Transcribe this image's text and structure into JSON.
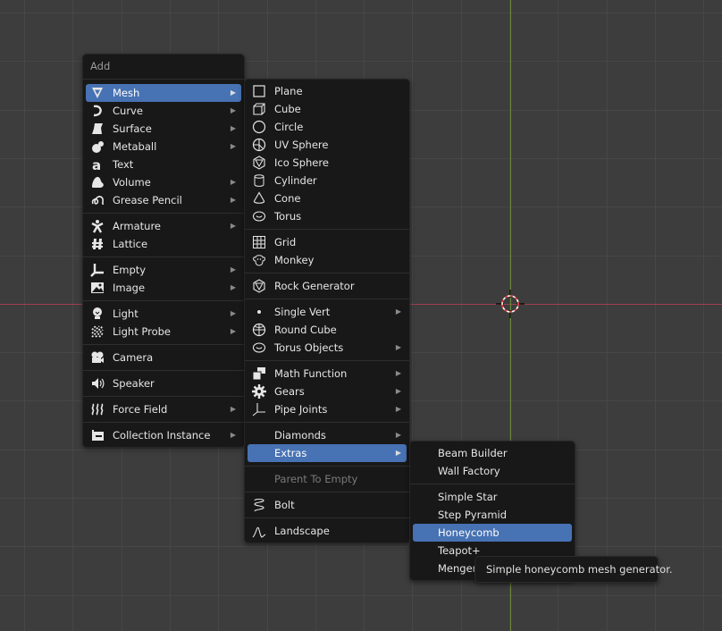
{
  "viewport": {
    "colors": {
      "background": "#3d3d3d",
      "grid": "#474747",
      "x_axis": "#a0414f",
      "y_axis": "#6c8a3a",
      "highlight": "#4772b3"
    }
  },
  "add_menu": {
    "title": "Add",
    "groups": [
      [
        {
          "label": "Mesh",
          "icon": "mesh-icon",
          "submenu": true,
          "active": true
        },
        {
          "label": "Curve",
          "icon": "curve-icon",
          "submenu": true
        },
        {
          "label": "Surface",
          "icon": "surface-icon",
          "submenu": true
        },
        {
          "label": "Metaball",
          "icon": "metaball-icon",
          "submenu": true
        },
        {
          "label": "Text",
          "icon": "text-icon",
          "submenu": false
        },
        {
          "label": "Volume",
          "icon": "volume-icon",
          "submenu": true
        },
        {
          "label": "Grease Pencil",
          "icon": "grease-pencil-icon",
          "submenu": true
        }
      ],
      [
        {
          "label": "Armature",
          "icon": "armature-icon",
          "submenu": true
        },
        {
          "label": "Lattice",
          "icon": "lattice-icon",
          "submenu": false
        }
      ],
      [
        {
          "label": "Empty",
          "icon": "empty-icon",
          "submenu": true
        },
        {
          "label": "Image",
          "icon": "image-icon",
          "submenu": true
        }
      ],
      [
        {
          "label": "Light",
          "icon": "light-icon",
          "submenu": true
        },
        {
          "label": "Light Probe",
          "icon": "light-probe-icon",
          "submenu": true
        }
      ],
      [
        {
          "label": "Camera",
          "icon": "camera-icon",
          "submenu": false
        }
      ],
      [
        {
          "label": "Speaker",
          "icon": "speaker-icon",
          "submenu": false
        }
      ],
      [
        {
          "label": "Force Field",
          "icon": "force-field-icon",
          "submenu": true
        }
      ],
      [
        {
          "label": "Collection Instance",
          "icon": "collection-instance-icon",
          "submenu": true
        }
      ]
    ]
  },
  "mesh_menu": {
    "groups": [
      [
        {
          "label": "Plane",
          "icon": "plane-icon"
        },
        {
          "label": "Cube",
          "icon": "cube-icon"
        },
        {
          "label": "Circle",
          "icon": "circle-icon"
        },
        {
          "label": "UV Sphere",
          "icon": "uv-sphere-icon"
        },
        {
          "label": "Ico Sphere",
          "icon": "ico-sphere-icon"
        },
        {
          "label": "Cylinder",
          "icon": "cylinder-icon"
        },
        {
          "label": "Cone",
          "icon": "cone-icon"
        },
        {
          "label": "Torus",
          "icon": "torus-icon"
        }
      ],
      [
        {
          "label": "Grid",
          "icon": "grid-icon"
        },
        {
          "label": "Monkey",
          "icon": "monkey-icon"
        }
      ],
      [
        {
          "label": "Rock Generator",
          "icon": "rock-icon"
        }
      ],
      [
        {
          "label": "Single Vert",
          "icon": "vertex-icon",
          "submenu": true
        },
        {
          "label": "Round Cube",
          "icon": "round-cube-icon"
        },
        {
          "label": "Torus Objects",
          "icon": "torus-objects-icon",
          "submenu": true
        }
      ],
      [
        {
          "label": "Math Function",
          "icon": "math-function-icon",
          "submenu": true
        },
        {
          "label": "Gears",
          "icon": "gears-icon",
          "submenu": true
        },
        {
          "label": "Pipe Joints",
          "icon": "pipe-joints-icon",
          "submenu": true
        }
      ],
      [
        {
          "label": "Diamonds",
          "icon": "",
          "submenu": true
        },
        {
          "label": "Extras",
          "icon": "",
          "submenu": true,
          "active": true
        }
      ],
      [
        {
          "label": "Parent To Empty",
          "icon": "",
          "disabled": true
        }
      ],
      [
        {
          "label": "Bolt",
          "icon": "bolt-icon"
        }
      ],
      [
        {
          "label": "Landscape",
          "icon": "landscape-icon"
        }
      ]
    ]
  },
  "extras_menu": {
    "groups": [
      [
        {
          "label": "Beam Builder"
        },
        {
          "label": "Wall Factory"
        }
      ],
      [
        {
          "label": "Simple Star"
        },
        {
          "label": "Step Pyramid"
        },
        {
          "label": "Honeycomb",
          "active": true
        },
        {
          "label": "Teapot+"
        },
        {
          "label": "Menger Sponge"
        }
      ]
    ]
  },
  "tooltip": {
    "text": "Simple honeycomb mesh generator."
  }
}
